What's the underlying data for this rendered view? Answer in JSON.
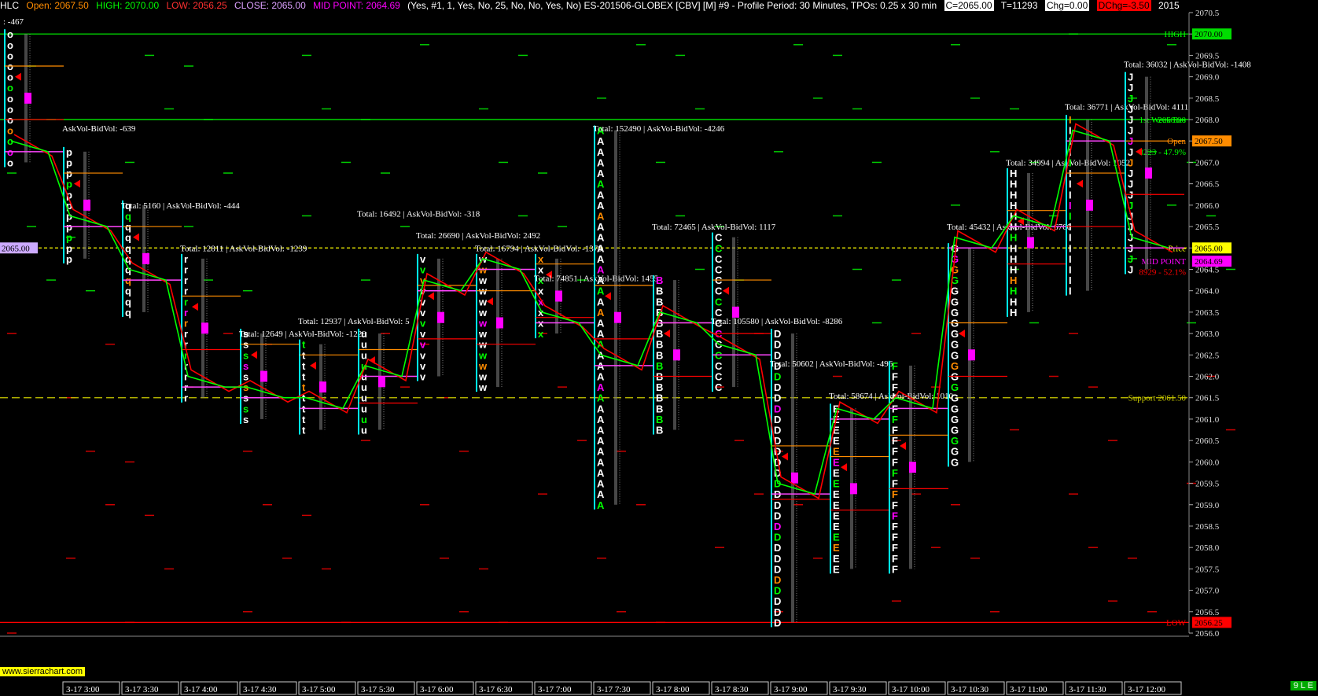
{
  "header": {
    "symbol": "HLC",
    "open": "Open: 2067.50",
    "high": "HIGH: 2070.00",
    "low": "LOW: 2056.25",
    "close": "CLOSE: 2065.00",
    "mid": "MID POINT: 2064.69",
    "params": "(Yes, #1, 1, Yes, No, 25, No, No, Yes, No)  ES-201506-GLOBEX [CBV] [M]  #9 - Profile Period: 30 Minutes, TPOs: 0.25 x 30 min",
    "c_box": "C=2065.00",
    "t_box": "T=11293",
    "chg_box": "Chg=0.00",
    "dchg_box": "DChg=-3.50",
    "year": "2015"
  },
  "colors": {
    "high": "#00ff00",
    "low": "#ff0000",
    "open": "#ff8c00",
    "mid": "#ff00ff",
    "close": "#ffff00",
    "support": "#cccc00",
    "poc": "#00ffff"
  },
  "watermark": "www.sierrachart.com",
  "status_badge": "9 L E",
  "chart_data": {
    "type": "market-profile",
    "y_axis": {
      "min": 2056.0,
      "max": 2070.5,
      "tick_step": 0.5
    },
    "x_ticks": [
      "3-17  3:00",
      "3-17  3:30",
      "3-17  4:00",
      "3-17  4:30",
      "3-17  5:00",
      "3-17  5:30",
      "3-17  6:00",
      "3-17  6:30",
      "3-17  7:00",
      "3-17  7:30",
      "3-17  8:00",
      "3-17  8:30",
      "3-17  9:00",
      "3-17  9:30",
      "3-17  10:00",
      "3-17  10:30",
      "3-17  11:00",
      "3-17  11:30",
      "3-17  12:00"
    ],
    "price_markers": [
      {
        "label": "2070.00",
        "price": 2070.0,
        "bg": "#00dd00",
        "fg": "#000"
      },
      {
        "label": "2067.50",
        "price": 2067.5,
        "bg": "#ff8c00",
        "fg": "#000"
      },
      {
        "label": "2065.00",
        "price": 2065.0,
        "bg": "#ffff00",
        "fg": "#000"
      },
      {
        "label": "2064.69",
        "price": 2064.69,
        "bg": "#ff00ff",
        "fg": "#000"
      },
      {
        "label": "2056.25",
        "price": 2056.25,
        "bg": "#ff0000",
        "fg": "#000"
      }
    ],
    "left_marker": {
      "label": "2065.00",
      "price": 2065.0
    },
    "lines": [
      {
        "name": "HIGH",
        "price": 2070.0,
        "color": "#00ff00",
        "dash": "",
        "label": "HIGH"
      },
      {
        "name": "1st Weak Res",
        "price": 2068.0,
        "color": "#00ff00",
        "dash": "",
        "label": "1st Weak  Res"
      },
      {
        "name": "Support",
        "price": 2061.5,
        "color": "#cccc00",
        "dash": "10,5",
        "label": "Support  2061.50"
      },
      {
        "name": "Price",
        "price": 2065.0,
        "color": "#ffff00",
        "dash": "4,3",
        "label": "Price"
      },
      {
        "name": "LOW",
        "price": 2056.25,
        "color": "#ff0000",
        "dash": "",
        "label": "LOW"
      }
    ],
    "right_labels": [
      {
        "text": "2068.00",
        "price": 2068.0,
        "color": "#00ff00"
      },
      {
        "text": "Open",
        "price": 2067.5,
        "color": "#ff8c00"
      },
      {
        "text": "8223 - 47.9%",
        "price": 2067.25,
        "color": "#00ff00"
      },
      {
        "text": "MID POINT",
        "price": 2064.69,
        "color": "#ff00ff"
      },
      {
        "text": "8929 - 52.1%",
        "price": 2064.44,
        "color": "#ff0000"
      }
    ],
    "profiles": [
      {
        "col": 0,
        "letter": "o",
        "hi": 2070.0,
        "lo": 2067.0,
        "total": "",
        "ask": ": -467",
        "ann_price": 2070.3
      },
      {
        "col": 1,
        "letter": "p",
        "hi": 2067.25,
        "lo": 2064.75,
        "total": "",
        "ask": "AskVol-BidVol: -639",
        "ann_price": 2067.8
      },
      {
        "col": 2,
        "letter": "q",
        "hi": 2066.0,
        "lo": 2063.5,
        "total": "Total: 5160",
        "ask": "AskVol-BidVol: -444",
        "ann_price": 2066.0
      },
      {
        "col": 3,
        "letter": "r",
        "hi": 2064.75,
        "lo": 2061.5,
        "total": "Total: 12811",
        "ask": "AskVol-BidVol: -1239",
        "ann_price": 2065.0
      },
      {
        "col": 4,
        "letter": "s",
        "hi": 2063.0,
        "lo": 2061.0,
        "total": "Total: 12649",
        "ask": "AskVol-BidVol: -1229",
        "ann_price": 2063.0
      },
      {
        "col": 5,
        "letter": "t",
        "hi": 2062.75,
        "lo": 2060.75,
        "total": "Total: 12937",
        "ask": "AskVol-BidVol: 5",
        "ann_price": 2063.3
      },
      {
        "col": 6,
        "letter": "u",
        "hi": 2063.0,
        "lo": 2060.75,
        "total": "Total: 16492",
        "ask": "AskVol-BidVol: -318",
        "ann_price": 2065.8
      },
      {
        "col": 7,
        "letter": "v",
        "hi": 2064.75,
        "lo": 2062.0,
        "total": "Total: 26690",
        "ask": "AskVol-BidVol: 2492",
        "ann_price": 2065.3
      },
      {
        "col": 8,
        "letter": "w",
        "hi": 2064.75,
        "lo": 2061.75,
        "total": "Total: 16794",
        "ask": "AskVol-BidVol: -1378",
        "ann_price": 2065.0
      },
      {
        "col": 9,
        "letter": "x",
        "hi": 2064.75,
        "lo": 2063.0,
        "total": "Total: 74851",
        "ask": "AskVol-BidVol: 1455",
        "ann_price": 2064.3
      },
      {
        "col": 10,
        "letter": "A",
        "hi": 2067.75,
        "lo": 2059.0,
        "total": "Total: 152490",
        "ask": "AskVol-BidVol: -4246",
        "ann_price": 2067.8
      },
      {
        "col": 11,
        "letter": "B",
        "hi": 2064.25,
        "lo": 2060.75,
        "total": "Total: 72465",
        "ask": "AskVol-BidVol: 1117",
        "ann_price": 2065.5
      },
      {
        "col": 12,
        "letter": "C",
        "hi": 2065.25,
        "lo": 2061.75,
        "total": "Total: 105580",
        "ask": "AskVol-BidVol: -8286",
        "ann_price": 2063.3
      },
      {
        "col": 13,
        "letter": "D",
        "hi": 2063.0,
        "lo": 2056.25,
        "total": "Total: 50602",
        "ask": "AskVol-BidVol: -496",
        "ann_price": 2062.3
      },
      {
        "col": 14,
        "letter": "E",
        "hi": 2061.25,
        "lo": 2057.5,
        "total": "Total: 58674",
        "ask": "AskVol-BidVol: 1010",
        "ann_price": 2061.55
      },
      {
        "col": 15,
        "letter": "F",
        "hi": 2062.25,
        "lo": 2057.5,
        "total": "",
        "ask": "",
        "ann_price": 0
      },
      {
        "col": 16,
        "letter": "G",
        "hi": 2065.0,
        "lo": 2060.0,
        "total": "Total: 45432",
        "ask": "AskVol-BidVol: 6766",
        "ann_price": 2065.5
      },
      {
        "col": 17,
        "letter": "H",
        "hi": 2066.75,
        "lo": 2063.5,
        "total": "Total: 34994",
        "ask": "AskVol-BidVol: 1052",
        "ann_price": 2067.0
      },
      {
        "col": 18,
        "letter": "I",
        "hi": 2068.0,
        "lo": 2064.0,
        "total": "Total: 36771",
        "ask": "AskVol-BidVol: 4111",
        "ann_price": 2068.3
      },
      {
        "col": 19,
        "letter": "J",
        "hi": 2069.0,
        "lo": 2064.5,
        "total": "Total: 36032",
        "ask": "AskVol-BidVol: -1408",
        "ann_price": 2069.3
      }
    ],
    "closes": [
      2067.25,
      2065.5,
      2064.25,
      2061.75,
      2061.5,
      2061.25,
      2062.0,
      2064.0,
      2064.5,
      2063.25,
      2062.25,
      2063.25,
      2062.5,
      2059.25,
      2061.0,
      2061.25,
      2065.0,
      2065.5,
      2067.5,
      2065.0
    ]
  }
}
